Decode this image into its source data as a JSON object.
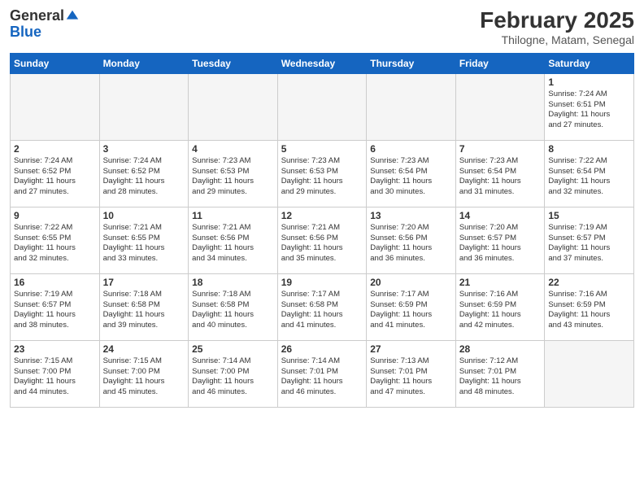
{
  "header": {
    "logo_general": "General",
    "logo_blue": "Blue",
    "month_title": "February 2025",
    "location": "Thilogne, Matam, Senegal"
  },
  "days_of_week": [
    "Sunday",
    "Monday",
    "Tuesday",
    "Wednesday",
    "Thursday",
    "Friday",
    "Saturday"
  ],
  "weeks": [
    [
      {
        "day": "",
        "info": ""
      },
      {
        "day": "",
        "info": ""
      },
      {
        "day": "",
        "info": ""
      },
      {
        "day": "",
        "info": ""
      },
      {
        "day": "",
        "info": ""
      },
      {
        "day": "",
        "info": ""
      },
      {
        "day": "1",
        "info": "Sunrise: 7:24 AM\nSunset: 6:51 PM\nDaylight: 11 hours\nand 27 minutes."
      }
    ],
    [
      {
        "day": "2",
        "info": "Sunrise: 7:24 AM\nSunset: 6:52 PM\nDaylight: 11 hours\nand 27 minutes."
      },
      {
        "day": "3",
        "info": "Sunrise: 7:24 AM\nSunset: 6:52 PM\nDaylight: 11 hours\nand 28 minutes."
      },
      {
        "day": "4",
        "info": "Sunrise: 7:23 AM\nSunset: 6:53 PM\nDaylight: 11 hours\nand 29 minutes."
      },
      {
        "day": "5",
        "info": "Sunrise: 7:23 AM\nSunset: 6:53 PM\nDaylight: 11 hours\nand 29 minutes."
      },
      {
        "day": "6",
        "info": "Sunrise: 7:23 AM\nSunset: 6:54 PM\nDaylight: 11 hours\nand 30 minutes."
      },
      {
        "day": "7",
        "info": "Sunrise: 7:23 AM\nSunset: 6:54 PM\nDaylight: 11 hours\nand 31 minutes."
      },
      {
        "day": "8",
        "info": "Sunrise: 7:22 AM\nSunset: 6:54 PM\nDaylight: 11 hours\nand 32 minutes."
      }
    ],
    [
      {
        "day": "9",
        "info": "Sunrise: 7:22 AM\nSunset: 6:55 PM\nDaylight: 11 hours\nand 32 minutes."
      },
      {
        "day": "10",
        "info": "Sunrise: 7:21 AM\nSunset: 6:55 PM\nDaylight: 11 hours\nand 33 minutes."
      },
      {
        "day": "11",
        "info": "Sunrise: 7:21 AM\nSunset: 6:56 PM\nDaylight: 11 hours\nand 34 minutes."
      },
      {
        "day": "12",
        "info": "Sunrise: 7:21 AM\nSunset: 6:56 PM\nDaylight: 11 hours\nand 35 minutes."
      },
      {
        "day": "13",
        "info": "Sunrise: 7:20 AM\nSunset: 6:56 PM\nDaylight: 11 hours\nand 36 minutes."
      },
      {
        "day": "14",
        "info": "Sunrise: 7:20 AM\nSunset: 6:57 PM\nDaylight: 11 hours\nand 36 minutes."
      },
      {
        "day": "15",
        "info": "Sunrise: 7:19 AM\nSunset: 6:57 PM\nDaylight: 11 hours\nand 37 minutes."
      }
    ],
    [
      {
        "day": "16",
        "info": "Sunrise: 7:19 AM\nSunset: 6:57 PM\nDaylight: 11 hours\nand 38 minutes."
      },
      {
        "day": "17",
        "info": "Sunrise: 7:18 AM\nSunset: 6:58 PM\nDaylight: 11 hours\nand 39 minutes."
      },
      {
        "day": "18",
        "info": "Sunrise: 7:18 AM\nSunset: 6:58 PM\nDaylight: 11 hours\nand 40 minutes."
      },
      {
        "day": "19",
        "info": "Sunrise: 7:17 AM\nSunset: 6:58 PM\nDaylight: 11 hours\nand 41 minutes."
      },
      {
        "day": "20",
        "info": "Sunrise: 7:17 AM\nSunset: 6:59 PM\nDaylight: 11 hours\nand 41 minutes."
      },
      {
        "day": "21",
        "info": "Sunrise: 7:16 AM\nSunset: 6:59 PM\nDaylight: 11 hours\nand 42 minutes."
      },
      {
        "day": "22",
        "info": "Sunrise: 7:16 AM\nSunset: 6:59 PM\nDaylight: 11 hours\nand 43 minutes."
      }
    ],
    [
      {
        "day": "23",
        "info": "Sunrise: 7:15 AM\nSunset: 7:00 PM\nDaylight: 11 hours\nand 44 minutes."
      },
      {
        "day": "24",
        "info": "Sunrise: 7:15 AM\nSunset: 7:00 PM\nDaylight: 11 hours\nand 45 minutes."
      },
      {
        "day": "25",
        "info": "Sunrise: 7:14 AM\nSunset: 7:00 PM\nDaylight: 11 hours\nand 46 minutes."
      },
      {
        "day": "26",
        "info": "Sunrise: 7:14 AM\nSunset: 7:01 PM\nDaylight: 11 hours\nand 46 minutes."
      },
      {
        "day": "27",
        "info": "Sunrise: 7:13 AM\nSunset: 7:01 PM\nDaylight: 11 hours\nand 47 minutes."
      },
      {
        "day": "28",
        "info": "Sunrise: 7:12 AM\nSunset: 7:01 PM\nDaylight: 11 hours\nand 48 minutes."
      },
      {
        "day": "",
        "info": ""
      }
    ]
  ]
}
